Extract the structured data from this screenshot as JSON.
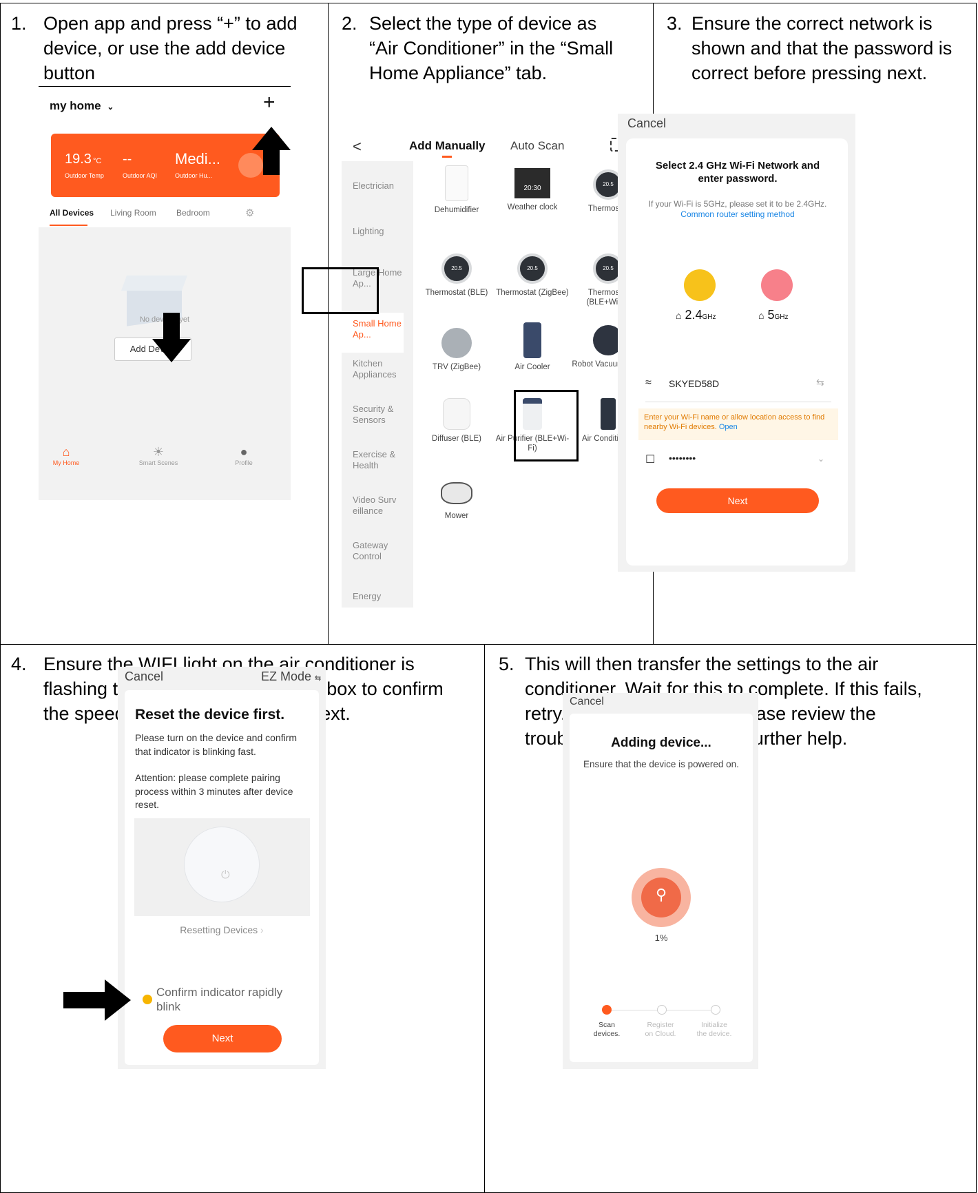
{
  "steps": {
    "s1": {
      "num": "1.",
      "text": "Open app and press “+” to add device, or use the add device button"
    },
    "s2": {
      "num": "2.",
      "text": "Select the type of device as  “Air Conditioner” in the “Small Home Appliance” tab."
    },
    "s3": {
      "num": "3.",
      "text": "Ensure the correct network is shown and that the password is correct before pressing next."
    },
    "s4": {
      "num": "4.",
      "text": "Ensure the WIFI light on the air conditioner is flashing twice per second,  tick the box to confirm the speed of flashing and press Next."
    },
    "s5": {
      "num": "5.",
      "text": "This will then transfer the settings to the air conditioner. Wait for this to complete. If this fails, retry. If still unsuccessful please review the troubleshooting section for further help."
    }
  },
  "app1": {
    "home_title": "my home",
    "plus": "+",
    "temp": "19.3",
    "temp_unit": "°C",
    "aqi": "--",
    "humidity": "Medi...",
    "lbl_temp": "Outdoor Temp",
    "lbl_aqi": "Outdoor AQI",
    "lbl_hum": "Outdoor Hu...",
    "tabs": [
      "All Devices",
      "Living Room",
      "Bedroom"
    ],
    "no_devices": "No devices yet",
    "add_device": "Add Device",
    "nav": [
      "My Home",
      "Smart Scenes",
      "Profile"
    ]
  },
  "app2": {
    "back": "<",
    "tab_manual": "Add Manually",
    "tab_auto": "Auto Scan",
    "categories": [
      "Electrician",
      "Lighting",
      "Large Home Ap...",
      "Small Home Ap...",
      "Kitchen Appliances",
      "Security & Sensors",
      "Exercise & Health",
      "Video Surv eillance",
      "Gateway Control",
      "Energy"
    ],
    "devices": [
      "Dehumidifier",
      "Weather clock",
      "Thermostat",
      "Thermostat (BLE)",
      "Thermostat (ZigBee)",
      "Thermostat (BLE+Wi-Fi)",
      "TRV (ZigBee)",
      "Air Cooler",
      "Robot Vacuum (IPC)",
      "Diffuser (BLE)",
      "Air Purifier (BLE+Wi-Fi)",
      "Air Conditioner",
      "Mower"
    ],
    "clock_time": "20:30",
    "thermo_val": "20.5"
  },
  "app3": {
    "cancel": "Cancel",
    "title": "Select 2.4 GHz Wi-Fi Network and enter password.",
    "note": "If your Wi-Fi is 5GHz, please set it to be 2.4GHz.",
    "link": "Common router setting method",
    "band1": "2.4",
    "band2": "5",
    "ghz": "GHz",
    "ssid": "SKYED58D",
    "warning": "Enter your Wi-Fi name or allow location access to find nearby Wi-Fi devices.",
    "warning_link": "Open",
    "password": "••••••••",
    "next": "Next"
  },
  "app4": {
    "cancel": "Cancel",
    "mode": "EZ Mode",
    "title": "Reset the device first.",
    "body": "Please turn on the device and confirm that indicator is blinking fast.",
    "attention": "Attention: please complete pairing process within 3 minutes after device reset.",
    "resetting": "Resetting Devices",
    "confirm": "Confirm indicator rapidly blink",
    "next": "Next"
  },
  "app5": {
    "cancel": "Cancel",
    "title": "Adding device...",
    "subtitle": "Ensure that the device is powered on.",
    "percent": "1%",
    "steps": [
      "Scan devices.",
      "Register on Cloud.",
      "Initialize the device."
    ]
  },
  "colors": {
    "accent": "#ff5a1f",
    "link": "#1e88e5",
    "yellow": "#f7c21b",
    "pink": "#f7808a"
  }
}
